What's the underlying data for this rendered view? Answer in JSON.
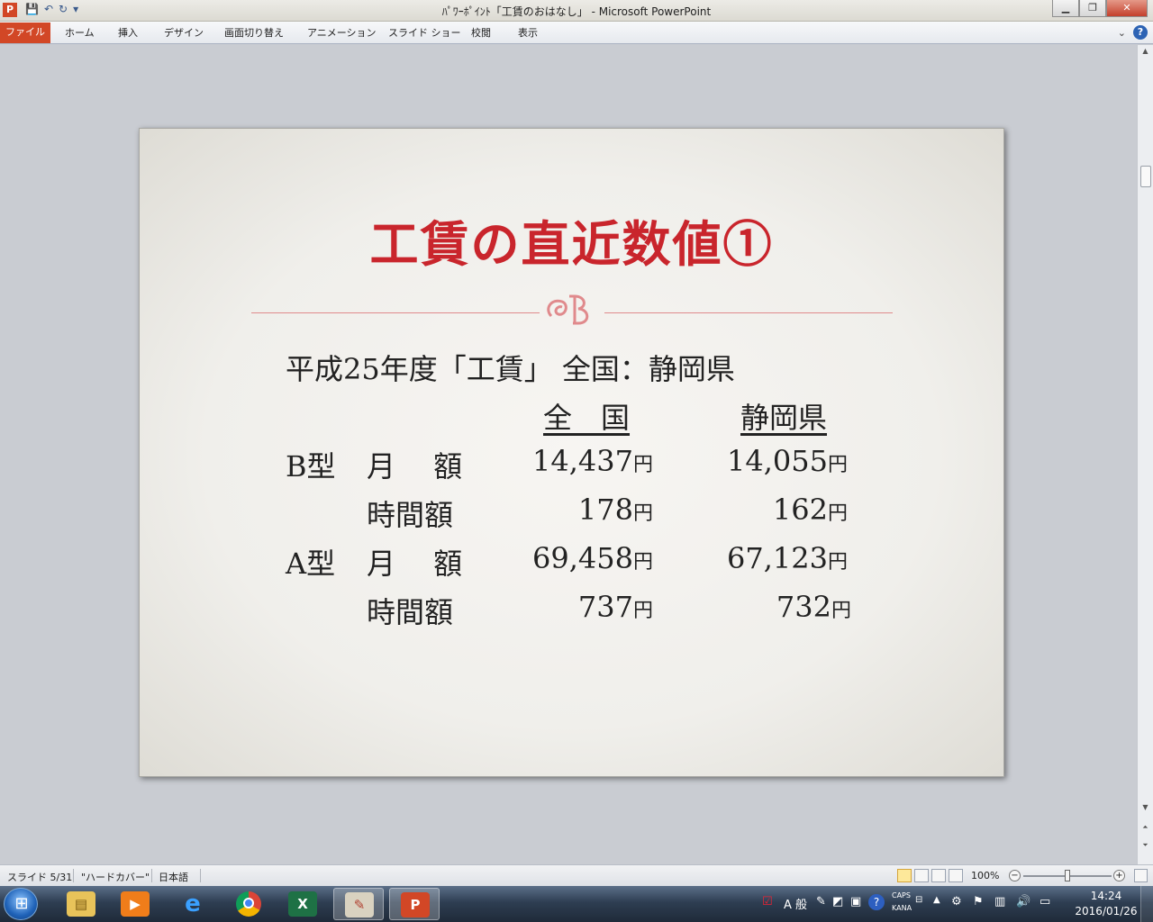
{
  "window": {
    "title": "ﾊﾟﾜｰﾎﾟｲﾝﾄ「工賃のおはなし」 - Microsoft PowerPoint",
    "app_icon": "P"
  },
  "ribbon": {
    "tabs": [
      "ファイル",
      "ホーム",
      "挿入",
      "デザイン",
      "画面切り替え",
      "アニメーション",
      "スライド ショー",
      "校閲",
      "表示"
    ]
  },
  "slide": {
    "title": "工賃の直近数値①",
    "subheading": "平成25年度「工賃」 全国：静岡県",
    "column_headers": [
      "全　国",
      "静岡県"
    ],
    "unit": "円",
    "rows": [
      {
        "type": "B型",
        "label": "月　 額",
        "national": "14,437",
        "shizuoka": "14,055"
      },
      {
        "type": "",
        "label": "時間額",
        "national": "178",
        "shizuoka": "162"
      },
      {
        "type": "A型",
        "label": "月　 額",
        "national": "69,458",
        "shizuoka": "67,123"
      },
      {
        "type": "",
        "label": "時間額",
        "national": "737",
        "shizuoka": "732"
      }
    ]
  },
  "statusbar": {
    "slide_counter": "スライド 5/31",
    "theme": "\"ハードカバー\"",
    "language": "日本語",
    "zoom": "100%"
  },
  "taskbar": {
    "apps": [
      "file-explorer",
      "media-player",
      "internet-explorer",
      "chrome",
      "excel",
      "paint",
      "powerpoint"
    ],
    "ime_label": "A 般",
    "caps_label": "CAPS",
    "kana_label": "KANA",
    "time": "14:24",
    "date": "2016/01/26"
  },
  "colors": {
    "title_red": "#c9252c",
    "file_tab": "#d24726",
    "ornament": "#e08a8c"
  }
}
